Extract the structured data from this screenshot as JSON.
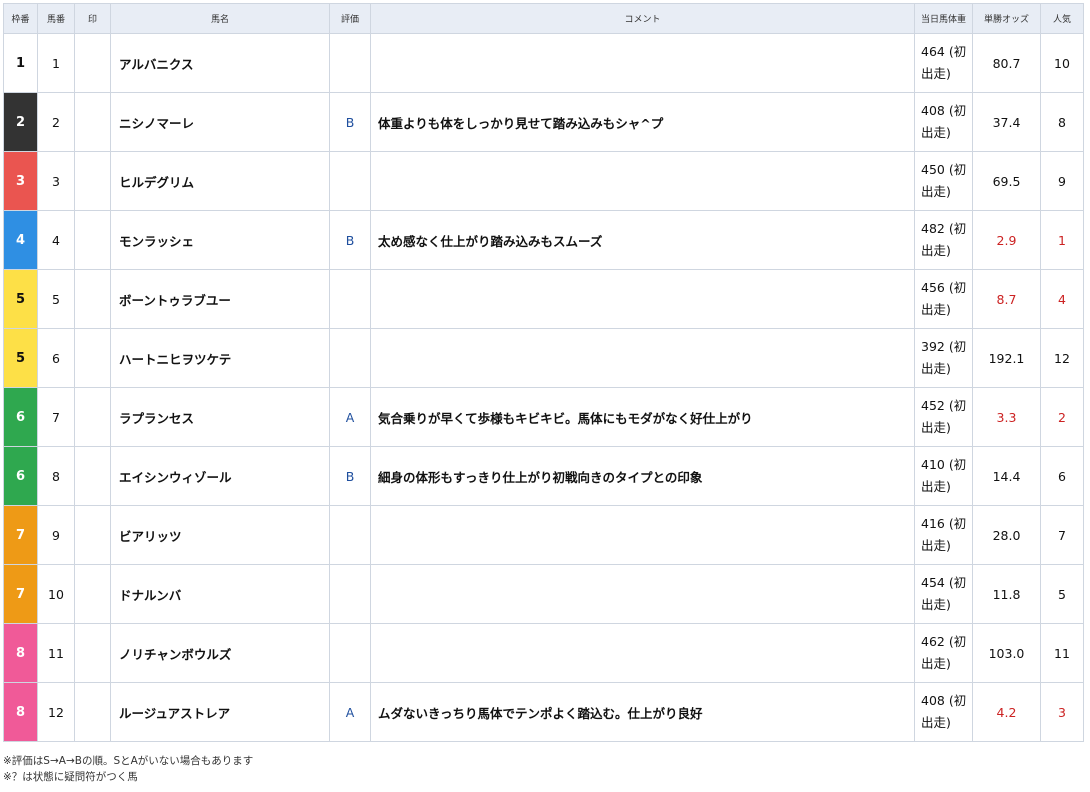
{
  "headers": {
    "waku": "枠番",
    "uma": "馬番",
    "mark": "印",
    "name": "馬名",
    "eval": "評価",
    "comment": "コメント",
    "weight": "当日馬体重",
    "odds": "単勝オッズ",
    "pop": "人気"
  },
  "waku_colors": {
    "1": {
      "bg": "#ffffff",
      "fg": "#111111"
    },
    "2": {
      "bg": "#333333",
      "fg": "#ffffff"
    },
    "3": {
      "bg": "#ea5550",
      "fg": "#ffffff"
    },
    "4": {
      "bg": "#2f8fe3",
      "fg": "#ffffff"
    },
    "5": {
      "bg": "#fde047",
      "fg": "#111111"
    },
    "6": {
      "bg": "#2fa84f",
      "fg": "#ffffff"
    },
    "7": {
      "bg": "#ee9a16",
      "fg": "#ffffff"
    },
    "8": {
      "bg": "#f05a98",
      "fg": "#ffffff"
    }
  },
  "hot_color": "#cc2222",
  "rows": [
    {
      "waku": "1",
      "uma": "1",
      "mark": "",
      "name": "アルバニクス",
      "eval": "",
      "comment": "",
      "weight": "464 (初出走)",
      "odds": "80.7",
      "pop": "10",
      "hot": false
    },
    {
      "waku": "2",
      "uma": "2",
      "mark": "",
      "name": "ニシノマーレ",
      "eval": "B",
      "comment": "体重よりも体をしっかり見せて踏み込みもシャ^プ",
      "weight": "408 (初出走)",
      "odds": "37.4",
      "pop": "8",
      "hot": false
    },
    {
      "waku": "3",
      "uma": "3",
      "mark": "",
      "name": "ヒルデグリム",
      "eval": "",
      "comment": "",
      "weight": "450 (初出走)",
      "odds": "69.5",
      "pop": "9",
      "hot": false
    },
    {
      "waku": "4",
      "uma": "4",
      "mark": "",
      "name": "モンラッシェ",
      "eval": "B",
      "comment": "太め感なく仕上がり踏み込みもスムーズ",
      "weight": "482 (初出走)",
      "odds": "2.9",
      "pop": "1",
      "hot": true
    },
    {
      "waku": "5",
      "uma": "5",
      "mark": "",
      "name": "ボーントゥラブユー",
      "eval": "",
      "comment": "",
      "weight": "456 (初出走)",
      "odds": "8.7",
      "pop": "4",
      "hot": true
    },
    {
      "waku": "5",
      "uma": "6",
      "mark": "",
      "name": "ハートニヒヲツケテ",
      "eval": "",
      "comment": "",
      "weight": "392 (初出走)",
      "odds": "192.1",
      "pop": "12",
      "hot": false
    },
    {
      "waku": "6",
      "uma": "7",
      "mark": "",
      "name": "ラプランセス",
      "eval": "A",
      "comment": "気合乗りが早くて歩様もキビキビ。馬体にもモダがなく好仕上がり",
      "weight": "452 (初出走)",
      "odds": "3.3",
      "pop": "2",
      "hot": true
    },
    {
      "waku": "6",
      "uma": "8",
      "mark": "",
      "name": "エイシンウィゾール",
      "eval": "B",
      "comment": "細身の体形もすっきり仕上がり初戦向きのタイプとの印象",
      "weight": "410 (初出走)",
      "odds": "14.4",
      "pop": "6",
      "hot": false
    },
    {
      "waku": "7",
      "uma": "9",
      "mark": "",
      "name": "ビアリッツ",
      "eval": "",
      "comment": "",
      "weight": "416 (初出走)",
      "odds": "28.0",
      "pop": "7",
      "hot": false
    },
    {
      "waku": "7",
      "uma": "10",
      "mark": "",
      "name": "ドナルンバ",
      "eval": "",
      "comment": "",
      "weight": "454 (初出走)",
      "odds": "11.8",
      "pop": "5",
      "hot": false
    },
    {
      "waku": "8",
      "uma": "11",
      "mark": "",
      "name": "ノリチャンボウルズ",
      "eval": "",
      "comment": "",
      "weight": "462 (初出走)",
      "odds": "103.0",
      "pop": "11",
      "hot": false
    },
    {
      "waku": "8",
      "uma": "12",
      "mark": "",
      "name": "ルージュアストレア",
      "eval": "A",
      "comment": "ムダないきっちり馬体でテンポよく踏込む。仕上がり良好",
      "weight": "408 (初出走)",
      "odds": "4.2",
      "pop": "3",
      "hot": true
    }
  ],
  "notes": [
    "※評価はS→A→Bの順。SとAがいない場合もあります",
    "※？は状態に疑問符がつく馬"
  ]
}
